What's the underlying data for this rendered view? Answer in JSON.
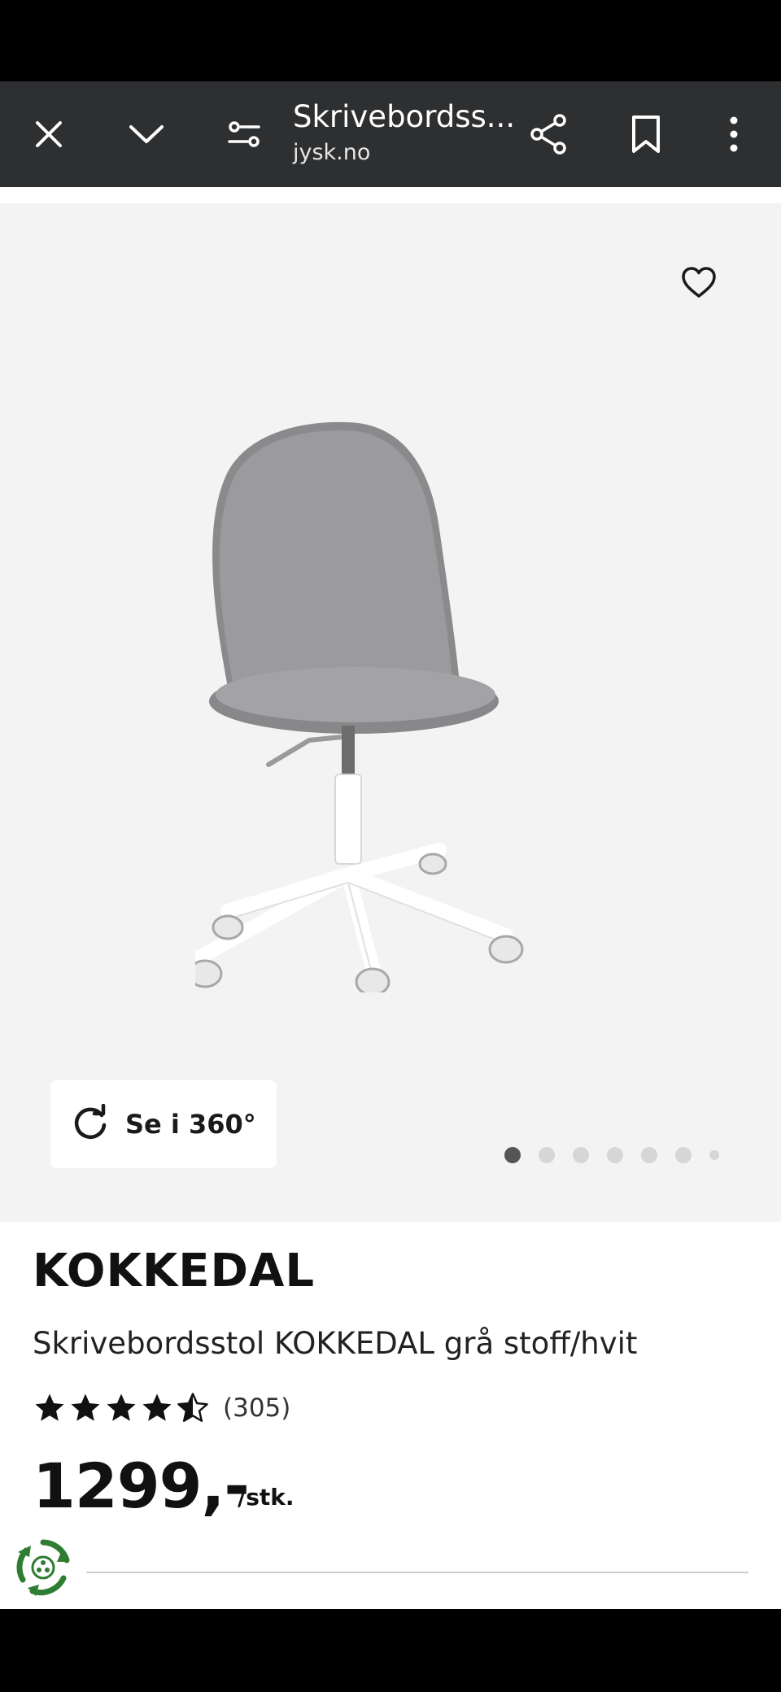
{
  "browser": {
    "title": "Skrivebordss...",
    "domain": "jysk.no",
    "icons": [
      "close-icon",
      "chevron-down-icon",
      "page-settings-icon",
      "share-icon",
      "bookmark-icon",
      "more-icon"
    ]
  },
  "gallery": {
    "view_360_label": "Se i 360°",
    "slide_count": 7,
    "active_slide": 1,
    "favorite_icon": "heart-outline-icon"
  },
  "product": {
    "brand": "KOKKEDAL",
    "name": "Skrivebordsstol KOKKEDAL grå stoff/hvit",
    "rating": 4.5,
    "rating_max": 5,
    "rating_count": "(305)",
    "price": "1299,-",
    "unit": "/stk."
  },
  "colors": {
    "browser_bar": "#2e2f31",
    "gallery_bg": "#f3f3f3",
    "eco_green": "#2f7d32"
  }
}
